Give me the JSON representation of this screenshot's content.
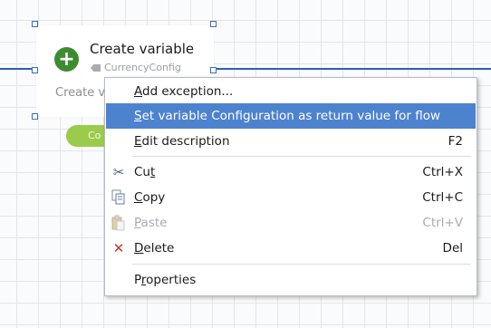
{
  "node": {
    "title": "Create variable",
    "tag": "CurrencyConfig",
    "description": "Create v",
    "pill": "Co"
  },
  "menu": {
    "items": [
      {
        "pre": "",
        "u": "A",
        "post": "dd exception...",
        "shortcut": ""
      },
      {
        "pre": "",
        "u": "S",
        "post": "et variable Configuration as return value for flow",
        "shortcut": ""
      },
      {
        "pre": "",
        "u": "E",
        "post": "dit description",
        "shortcut": "F2"
      },
      {
        "pre": "Cu",
        "u": "t",
        "post": "",
        "shortcut": "Ctrl+X",
        "icon": "scissors-icon"
      },
      {
        "pre": "",
        "u": "C",
        "post": "opy",
        "shortcut": "Ctrl+C",
        "icon": "copy-icon"
      },
      {
        "pre": "",
        "u": "P",
        "post": "aste",
        "shortcut": "Ctrl+V",
        "icon": "paste-icon"
      },
      {
        "pre": "",
        "u": "D",
        "post": "elete",
        "shortcut": "Del",
        "icon": "delete-icon"
      },
      {
        "pre": "P",
        "u": "r",
        "post": "operties",
        "shortcut": ""
      }
    ]
  },
  "colors": {
    "highlight": "#4d82cf",
    "flow_line": "#2f5fb5",
    "node_icon": "#3d8c2f",
    "delete_icon": "#c0392b"
  }
}
